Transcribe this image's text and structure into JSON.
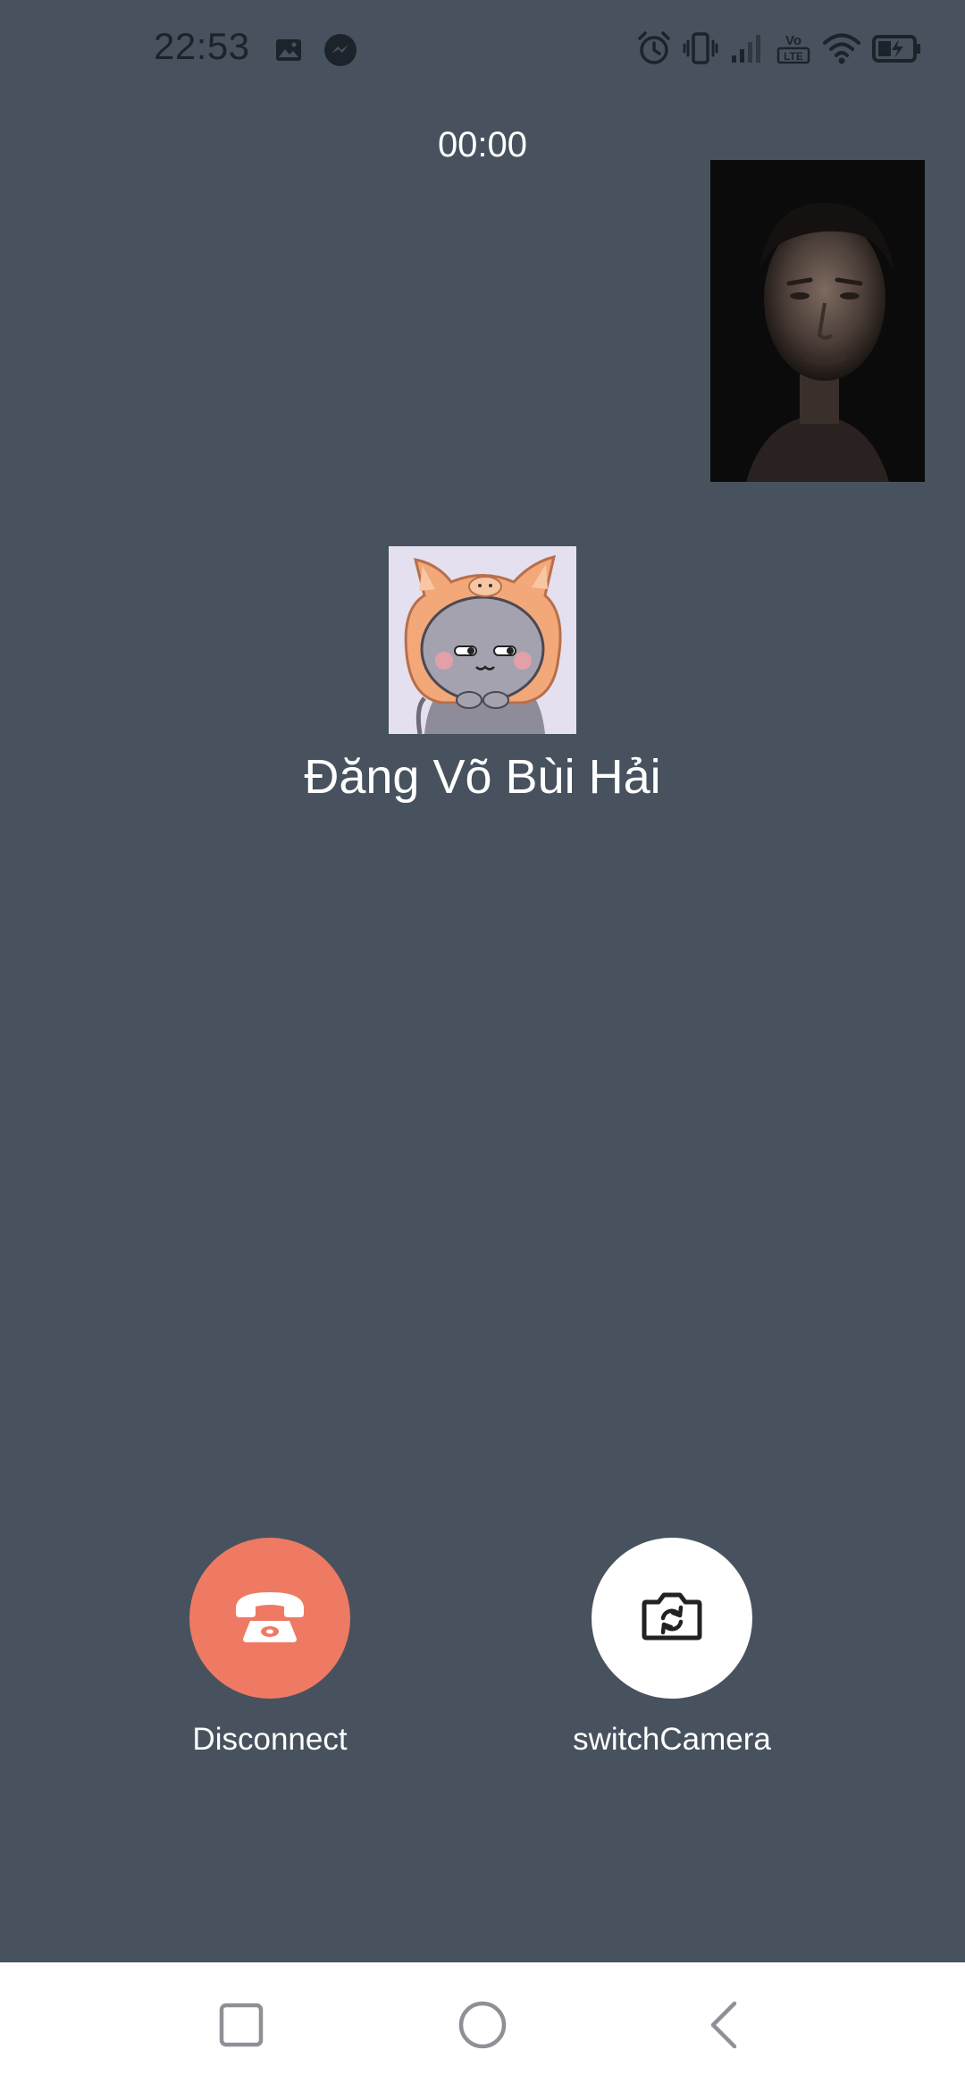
{
  "status_bar": {
    "time": "22:53",
    "left_icons": [
      "image-icon",
      "messenger-icon"
    ],
    "right_icons": [
      "alarm-icon",
      "vibrate-icon",
      "signal-icon",
      "volte-icon",
      "wifi-icon",
      "battery-icon"
    ],
    "volte_top": "Vo",
    "volte_bottom": "LTE",
    "text_color": "#1d232a"
  },
  "call": {
    "timer": "00:00",
    "contact_name": "Đăng Võ Bùi Hải",
    "avatar_icon": "cartoon-cat-avatar",
    "self_preview": "front-camera-preview"
  },
  "actions": {
    "disconnect": {
      "label": "Disconnect",
      "icon": "phone-hangup-icon",
      "color": "#ef7a64"
    },
    "switch_camera": {
      "label": "switchCamera",
      "icon": "camera-switch-icon",
      "color": "#ffffff"
    }
  },
  "nav": {
    "items": [
      "recents-icon",
      "home-icon",
      "back-icon"
    ]
  },
  "colors": {
    "background": "#47525e",
    "text": "#ffffff",
    "nav_background": "#ffffff",
    "nav_icon": "#8e9095"
  }
}
